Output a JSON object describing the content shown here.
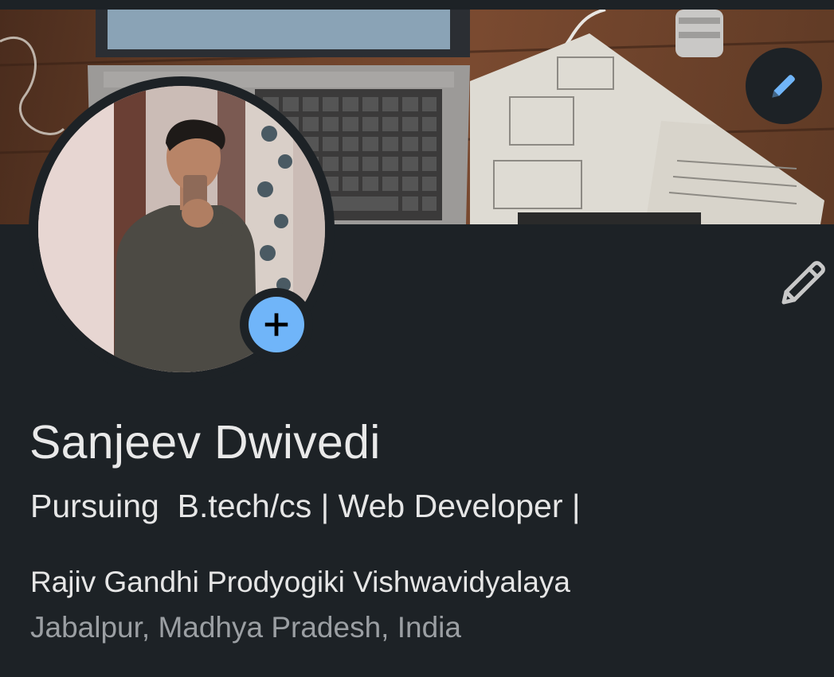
{
  "profile": {
    "name": "Sanjeev Dwivedi",
    "headline": "Pursuing  B.tech/cs | Web Developer |",
    "school": "Rajiv Gandhi Prodyogiki Vishwavidyalaya",
    "location": "Jabalpur, Madhya Pradesh, India"
  },
  "icons": {
    "banner_edit": "pencil-icon",
    "add_photo": "plus-icon",
    "profile_edit": "pencil-icon"
  },
  "colors": {
    "background": "#1d2226",
    "accent": "#70b5f9",
    "text_primary": "#e9e9e9",
    "text_secondary": "#9b9fa3"
  }
}
